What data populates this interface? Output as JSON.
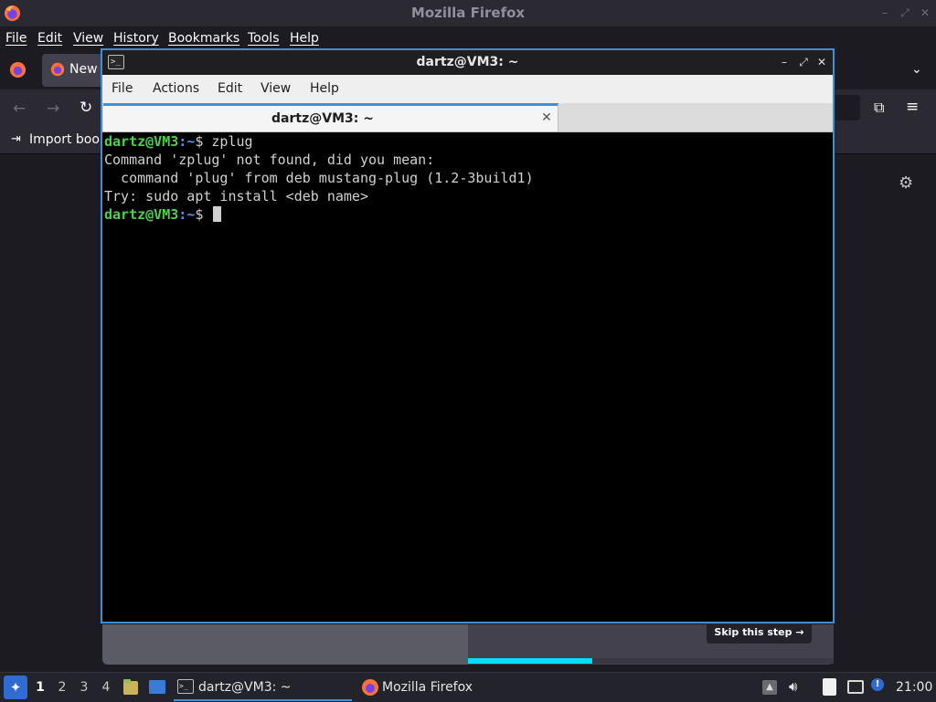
{
  "firefox": {
    "title": "Mozilla Firefox",
    "menu": [
      "File",
      "Edit",
      "View",
      "History",
      "Bookmarks",
      "Tools",
      "Help"
    ],
    "tab_label": "New",
    "bookmarks_label": "Import book",
    "skip_label": "Skip this step →",
    "onboarding_progress": 0.34
  },
  "terminal": {
    "title": "dartz@VM3: ~",
    "menu": [
      "File",
      "Actions",
      "Edit",
      "View",
      "Help"
    ],
    "tab_label": "dartz@VM3: ~",
    "lines": [
      {
        "user": "dartz@VM3",
        "path": ":~",
        "text": "$ zplug"
      },
      {
        "text": "Command 'zplug' not found, did you mean:"
      },
      {
        "text": "  command 'plug' from deb mustang-plug (1.2-3build1)"
      },
      {
        "text": "Try: sudo apt install <deb name>"
      },
      {
        "user": "dartz@VM3",
        "path": ":~",
        "text": "$ "
      }
    ]
  },
  "taskbar": {
    "workspaces": [
      "1",
      "2",
      "3",
      "4"
    ],
    "active_workspace": "1",
    "terminal_label": "dartz@VM3: ~",
    "firefox_label": "Mozilla Firefox",
    "clock": "21:00"
  },
  "colors": {
    "accent": "#3d8fd8",
    "prompt_user": "#4dd04d",
    "prompt_path": "#5f8fe8",
    "progress": "#00ddff"
  }
}
